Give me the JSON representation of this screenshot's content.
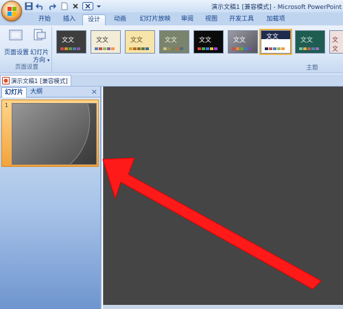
{
  "window": {
    "title": "演示文稿1 [兼容模式] - Microsoft PowerPoint"
  },
  "tabs": [
    {
      "label": "开始"
    },
    {
      "label": "插入"
    },
    {
      "label": "设计"
    },
    {
      "label": "动画"
    },
    {
      "label": "幻灯片放映"
    },
    {
      "label": "审阅"
    },
    {
      "label": "视图"
    },
    {
      "label": "开发工具"
    },
    {
      "label": "加载项"
    }
  ],
  "active_tab": "设计",
  "ribbon": {
    "page_setup_label": "页面设置",
    "slide_orientation_line1": "幻灯片",
    "slide_orientation_line2": "方向",
    "page_setup_group_label": "页面设置",
    "themes_group_label": "主题",
    "theme_sample_text": "文文",
    "themes": [
      {
        "bg": "#3d3d3d",
        "fg": "#ffffff",
        "name": "dark"
      },
      {
        "bg": "#f3ecd7",
        "fg": "#333333",
        "name": "paper"
      },
      {
        "bg": "#f7e4a8",
        "fg": "#5a4a1e",
        "name": "gold"
      },
      {
        "bg": "#7a836c",
        "fg": "#f1f1dc",
        "name": "olive"
      },
      {
        "bg": "#0b0b0b",
        "fg": "#ffffff",
        "name": "black"
      },
      {
        "bg": "#6c6c78",
        "fg": "#ffffff",
        "name": "gray-gradient"
      },
      {
        "bg": "#ffffff",
        "fg": "#1f2b4d",
        "name": "navy-banner"
      },
      {
        "bg": "#1f5c52",
        "fg": "#dfeee8",
        "name": "teal"
      },
      {
        "bg": "#f0e0e0",
        "fg": "#7a3a3a",
        "name": "partial"
      }
    ]
  },
  "document": {
    "tab_label": "演示文稿1 [兼容模式]"
  },
  "side_panel": {
    "tab_slides": "幻灯片",
    "tab_outline": "大纲",
    "close_glyph": "×",
    "slide_number": "1"
  },
  "colors": {
    "arrow": "#ff1a1a",
    "canvas": "#454545",
    "ribbon": "#dce8f7"
  }
}
